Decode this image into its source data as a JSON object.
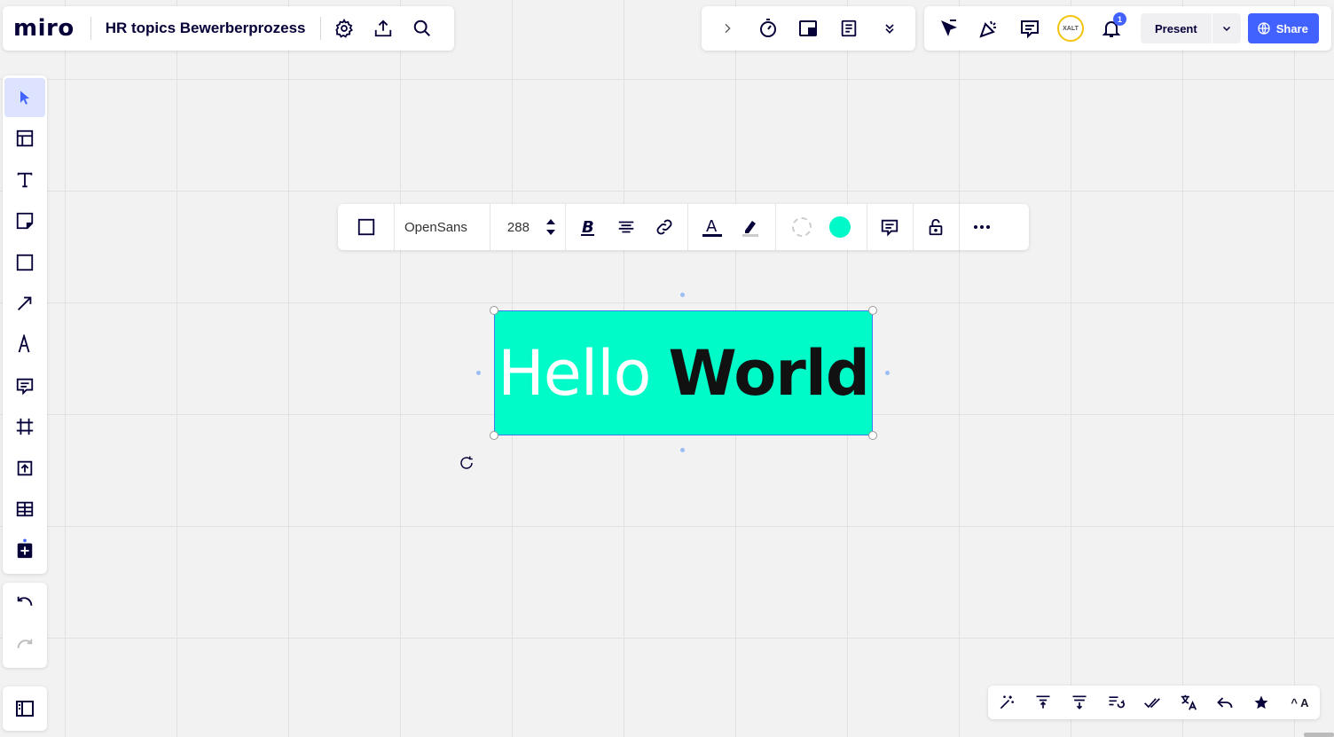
{
  "app": {
    "logo": "miro",
    "board_title": "HR topics Bewerberprozess"
  },
  "top_left": {
    "icons": [
      "gear-icon",
      "upload-icon",
      "search-icon"
    ]
  },
  "top_center": {
    "icons": [
      "chevron-right-icon",
      "timer-icon",
      "sticky-frame-icon",
      "notes-icon",
      "double-chevron-down-icon"
    ]
  },
  "top_right": {
    "icons": [
      "cursor-flag-icon",
      "celebrate-icon",
      "comments-icon"
    ],
    "avatar_text": "XALT",
    "notification_count": "1",
    "present_label": "Present",
    "share_label": "Share",
    "accent": "#4262ff"
  },
  "left_toolbar": {
    "tools": [
      "select",
      "templates",
      "text",
      "sticky-note",
      "shape",
      "arrow",
      "pen",
      "comment",
      "frame",
      "upload",
      "table",
      "add-more"
    ],
    "active": "select"
  },
  "context_toolbar": {
    "font_family": "OpenSans",
    "font_size": "288",
    "fill_color": "#00f9c8"
  },
  "canvas": {
    "text_box": {
      "word1": "Hello",
      "word2": "World",
      "fill_color": "#00fbc8",
      "word1_color": "#ffffff",
      "word2_color": "#111111"
    }
  },
  "bottom_right": {
    "icons": [
      "magic-wand-icon",
      "align-top-icon",
      "align-bottom-icon",
      "reorder-icon",
      "check-double-icon",
      "translate-icon",
      "reply-icon",
      "star-icon"
    ],
    "font_toggle_label": "^ A"
  }
}
